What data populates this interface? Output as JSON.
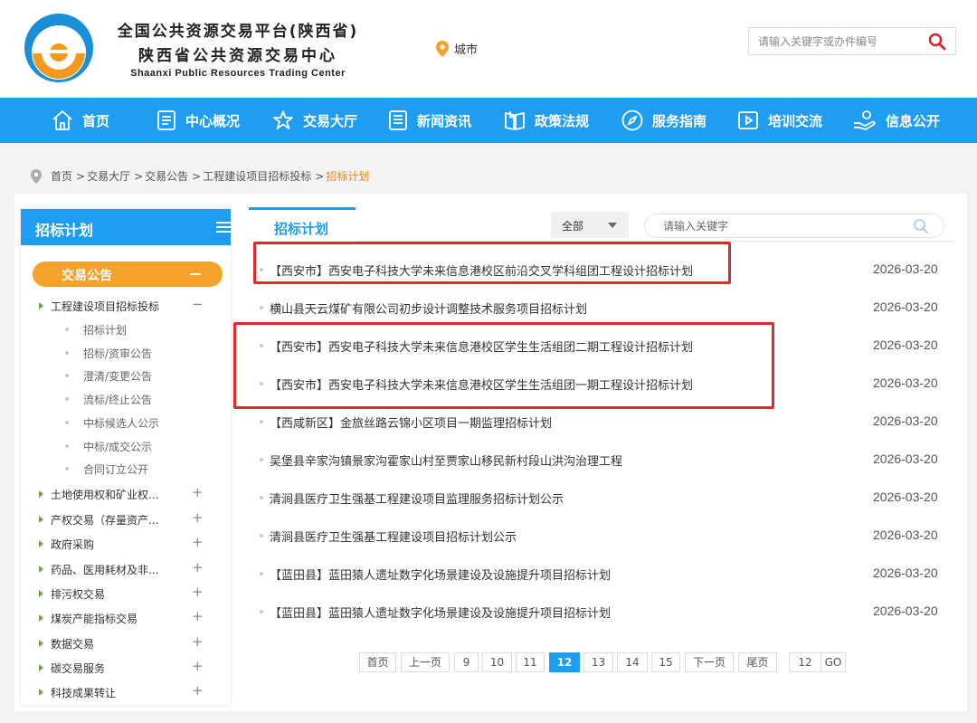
{
  "header": {
    "title_line1": "全国公共资源交易平台(陕西省)",
    "title_line2": "陕西省公共资源交易中心",
    "title_en": "Shaanxi Public Resources Trading Center",
    "city": "城市",
    "search_placeholder": "请输入关键字或办件编号"
  },
  "nav": {
    "items": [
      {
        "label": "首页",
        "icon": "home-icon"
      },
      {
        "label": "中心概况",
        "icon": "document-icon"
      },
      {
        "label": "交易大厅",
        "icon": "star-icon"
      },
      {
        "label": "新闻资讯",
        "icon": "news-icon"
      },
      {
        "label": "政策法规",
        "icon": "book-icon"
      },
      {
        "label": "服务指南",
        "icon": "compass-icon"
      },
      {
        "label": "培训交流",
        "icon": "video-icon"
      },
      {
        "label": "信息公开",
        "icon": "hand-icon"
      }
    ]
  },
  "breadcrumb": {
    "items": [
      "首页",
      "交易大厅",
      "交易公告",
      "工程建设项目招标投标"
    ],
    "current": "招标计划"
  },
  "sidebar": {
    "title": "招标计划",
    "category": "交易公告",
    "expanded": {
      "label": "工程建设项目招标投标",
      "toggle": "−"
    },
    "subitems": [
      "招标计划",
      "招标/资审公告",
      "澄清/变更公告",
      "流标/终止公告",
      "中标候选人公示",
      "中标/成交公示",
      "合同订立公开"
    ],
    "others": [
      {
        "label": "土地使用权和矿业权...",
        "toggle": "+"
      },
      {
        "label": "产权交易（存量资产...",
        "toggle": "+"
      },
      {
        "label": "政府采购",
        "toggle": "+"
      },
      {
        "label": "药品、医用耗材及非...",
        "toggle": "+"
      },
      {
        "label": "排污权交易",
        "toggle": "+"
      },
      {
        "label": "煤炭产能指标交易",
        "toggle": "+"
      },
      {
        "label": "数据交易",
        "toggle": "+"
      },
      {
        "label": "碳交易服务",
        "toggle": "+"
      },
      {
        "label": "科技成果转让",
        "toggle": "+"
      }
    ]
  },
  "content": {
    "tab": "招标计划",
    "filter_value": "全部",
    "search_placeholder": "请输入关键字",
    "items": [
      {
        "title": "【西安市】西安电子科技大学未来信息港校区前沿交叉学科组团工程设计招标计划",
        "date": "2026-03-20"
      },
      {
        "title": "横山县天云煤矿有限公司初步设计调整技术服务项目招标计划",
        "date": "2026-03-20"
      },
      {
        "title": "【西安市】西安电子科技大学未来信息港校区学生生活组团二期工程设计招标计划",
        "date": "2026-03-20"
      },
      {
        "title": "【西安市】西安电子科技大学未来信息港校区学生生活组团一期工程设计招标计划",
        "date": "2026-03-20"
      },
      {
        "title": "【西咸新区】金旅丝路云锦小区项目一期监理招标计划",
        "date": "2026-03-20"
      },
      {
        "title": "吴堡县辛家沟镇景家沟霍家山村至贾家山移民新村段山洪沟治理工程",
        "date": "2026-03-20"
      },
      {
        "title": "清涧县医疗卫生强基工程建设项目监理服务招标计划公示",
        "date": "2026-03-20"
      },
      {
        "title": "清涧县医疗卫生强基工程建设项目招标计划公示",
        "date": "2026-03-20"
      },
      {
        "title": "【蓝田县】蓝田猿人遗址数字化场景建设及设施提升项目招标计划",
        "date": "2026-03-20"
      },
      {
        "title": "【蓝田县】蓝田猿人遗址数字化场景建设及设施提升项目招标计划",
        "date": "2026-03-20"
      }
    ]
  },
  "pagination": {
    "first": "首页",
    "prev": "上一页",
    "pages": [
      "9",
      "10",
      "11",
      "12",
      "13",
      "14",
      "15"
    ],
    "current": "12",
    "next": "下一页",
    "last": "尾页",
    "jump_value": "12",
    "go": "GO"
  },
  "colors": {
    "primary": "#1e9df1",
    "orange": "#f6a22a",
    "highlight_box": "#e02a2a",
    "breadcrumb_active": "#f08519"
  }
}
